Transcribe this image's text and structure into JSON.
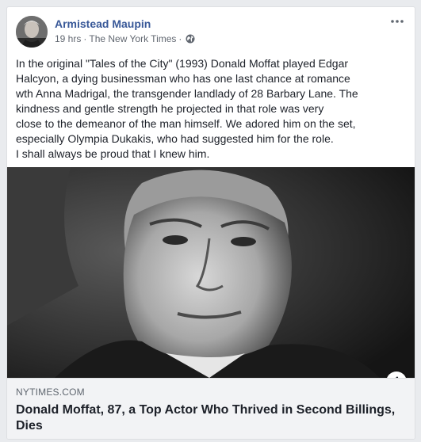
{
  "post": {
    "author": "Armistead Maupin",
    "time": "19 hrs",
    "separator": "·",
    "source": "The New York Times",
    "privacy_icon": "globe-icon",
    "more_icon": "more-options-icon",
    "text_lines": [
      "In the original \"Tales of the City\" (1993) Donald Moffat played Edgar",
      "Halcyon, a dying businessman who has one last chance at romance",
      "wth Anna Madrigal, the transgender landlady of 28 Barbary Lane. The",
      "kindness and gentle strength he projected in that role was very",
      "close to the demeanor of the man himself. We adored him on the set,",
      "especially Olympia Dukakis, who had suggested him for the role.",
      "I shall always be proud that I knew him."
    ]
  },
  "link": {
    "domain": "NYTIMES.COM",
    "title": "Donald Moffat, 87, a Top Actor Who Thrived in Second Billings, Dies",
    "info_label": "i"
  },
  "colors": {
    "author": "#385898",
    "link_bg": "#f2f3f5",
    "page_bg": "#e9ebee"
  }
}
